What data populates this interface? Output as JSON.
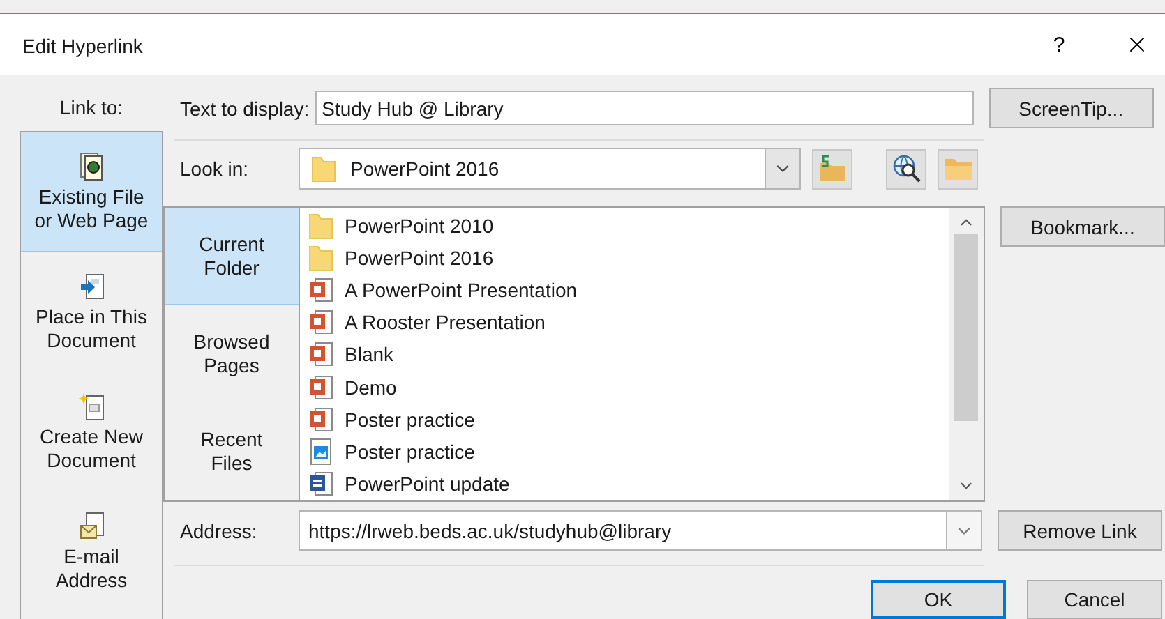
{
  "window": {
    "title": "Edit Hyperlink",
    "help": "?"
  },
  "link_to": {
    "label": "Link to:",
    "items": [
      {
        "label": "Existing File\nor Web Page",
        "kind": "existing",
        "selected": true
      },
      {
        "label": "Place in This\nDocument",
        "kind": "place",
        "selected": false
      },
      {
        "label": "Create New\nDocument",
        "kind": "create",
        "selected": false
      },
      {
        "label": "E-mail\nAddress",
        "kind": "email",
        "selected": false
      }
    ]
  },
  "text_to_display": {
    "label": "Text to display:",
    "value": "Study Hub @ Library"
  },
  "look_in": {
    "label": "Look in:",
    "value": "PowerPoint 2016"
  },
  "sources": [
    {
      "label": "Current\nFolder",
      "selected": true
    },
    {
      "label": "Browsed\nPages",
      "selected": false
    },
    {
      "label": "Recent\nFiles",
      "selected": false
    }
  ],
  "files": [
    {
      "name": "PowerPoint 2010",
      "kind": "folder"
    },
    {
      "name": "PowerPoint 2016",
      "kind": "folder"
    },
    {
      "name": "A PowerPoint Presentation",
      "kind": "powerpoint"
    },
    {
      "name": "A Rooster Presentation",
      "kind": "powerpoint"
    },
    {
      "name": "Blank",
      "kind": "powerpoint"
    },
    {
      "name": "Demo",
      "kind": "powerpoint"
    },
    {
      "name": "Poster practice",
      "kind": "powerpoint"
    },
    {
      "name": "Poster practice",
      "kind": "image"
    },
    {
      "name": "PowerPoint update",
      "kind": "word"
    }
  ],
  "address": {
    "label": "Address:",
    "value": "https://lrweb.beds.ac.uk/studyhub@library"
  },
  "side_buttons": {
    "screentip": "ScreenTip...",
    "bookmark": "Bookmark...",
    "remove_link": "Remove Link"
  },
  "buttons": [
    {
      "label": "OK",
      "default": true
    },
    {
      "label": "Cancel",
      "default": false
    }
  ]
}
